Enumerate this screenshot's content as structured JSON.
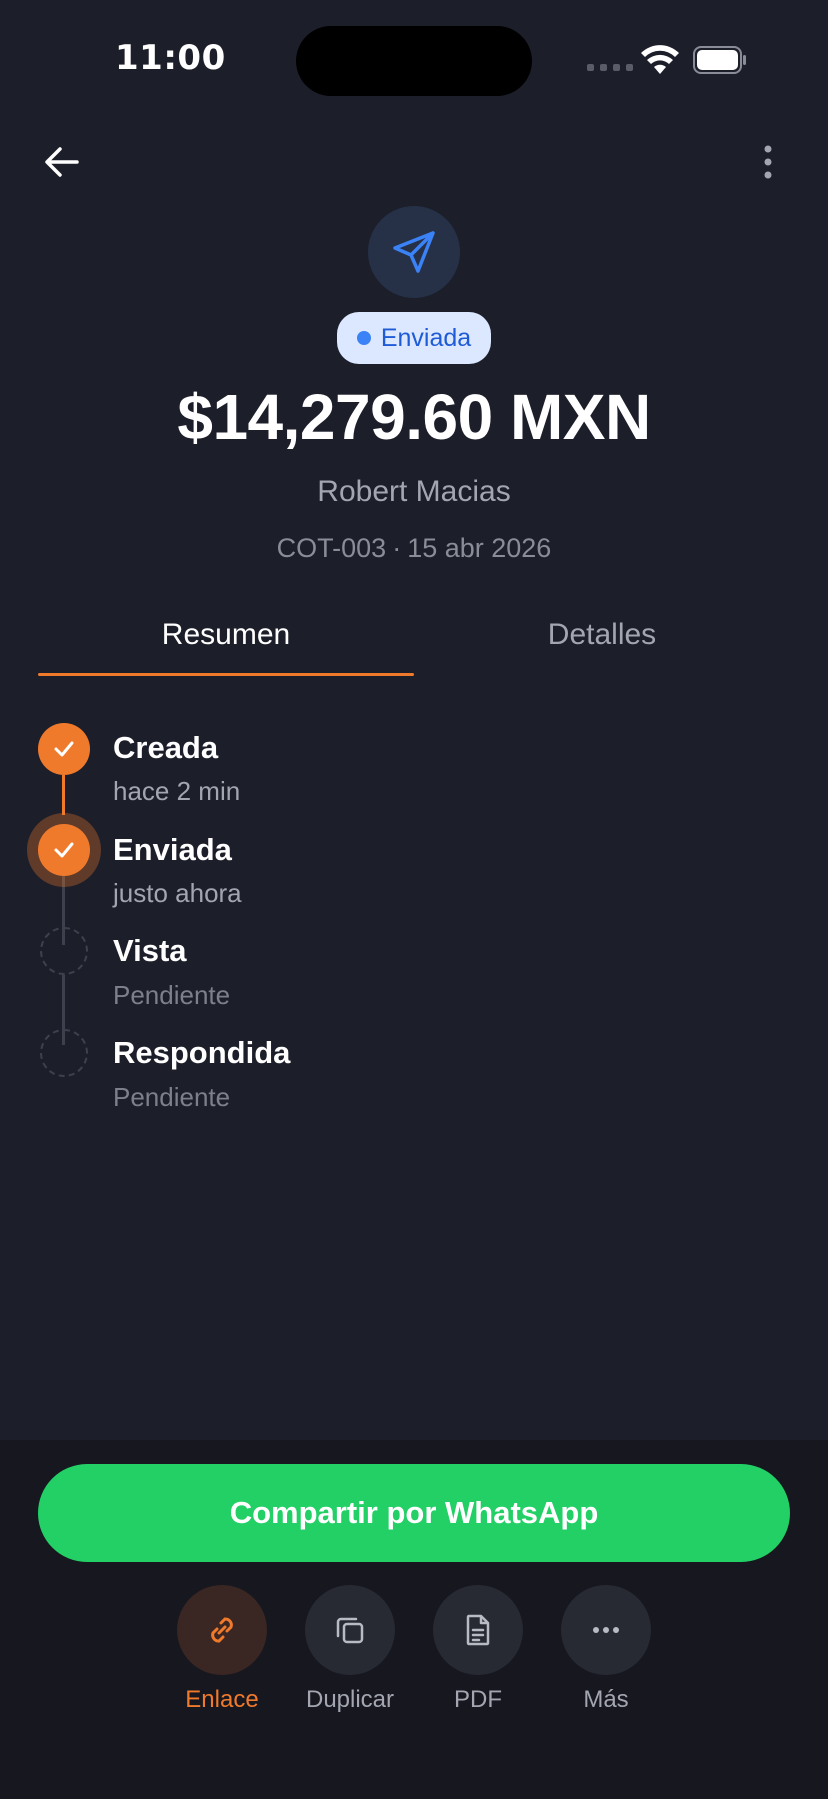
{
  "status_bar": {
    "time": "11:00"
  },
  "quote": {
    "status": "Enviada",
    "amount": "$14,279.60 MXN",
    "client": "Robert Macias",
    "code": "COT-003",
    "separator": "·",
    "date": "15 abr 2026"
  },
  "tabs": [
    {
      "label": "Resumen",
      "active": true
    },
    {
      "label": "Detalles",
      "active": false
    }
  ],
  "timeline": [
    {
      "title": "Creada",
      "subtitle": "hace 2 min",
      "state": "done"
    },
    {
      "title": "Enviada",
      "subtitle": "justo ahora",
      "state": "current"
    },
    {
      "title": "Vista",
      "subtitle": "Pendiente",
      "state": "pending"
    },
    {
      "title": "Respondida",
      "subtitle": "Pendiente",
      "state": "pending"
    }
  ],
  "primary_action": {
    "label": "Compartir por WhatsApp"
  },
  "actions": [
    {
      "label": "Enlace",
      "icon": "link-icon",
      "active": true
    },
    {
      "label": "Duplicar",
      "icon": "duplicate-icon",
      "active": false
    },
    {
      "label": "PDF",
      "icon": "document-icon",
      "active": false
    },
    {
      "label": "Más",
      "icon": "more-horizontal-icon",
      "active": false
    }
  ],
  "colors": {
    "background": "#1c1e2a",
    "accent": "#f07a2c",
    "whatsapp": "#22d066",
    "status_blue": "#3b82f6"
  }
}
